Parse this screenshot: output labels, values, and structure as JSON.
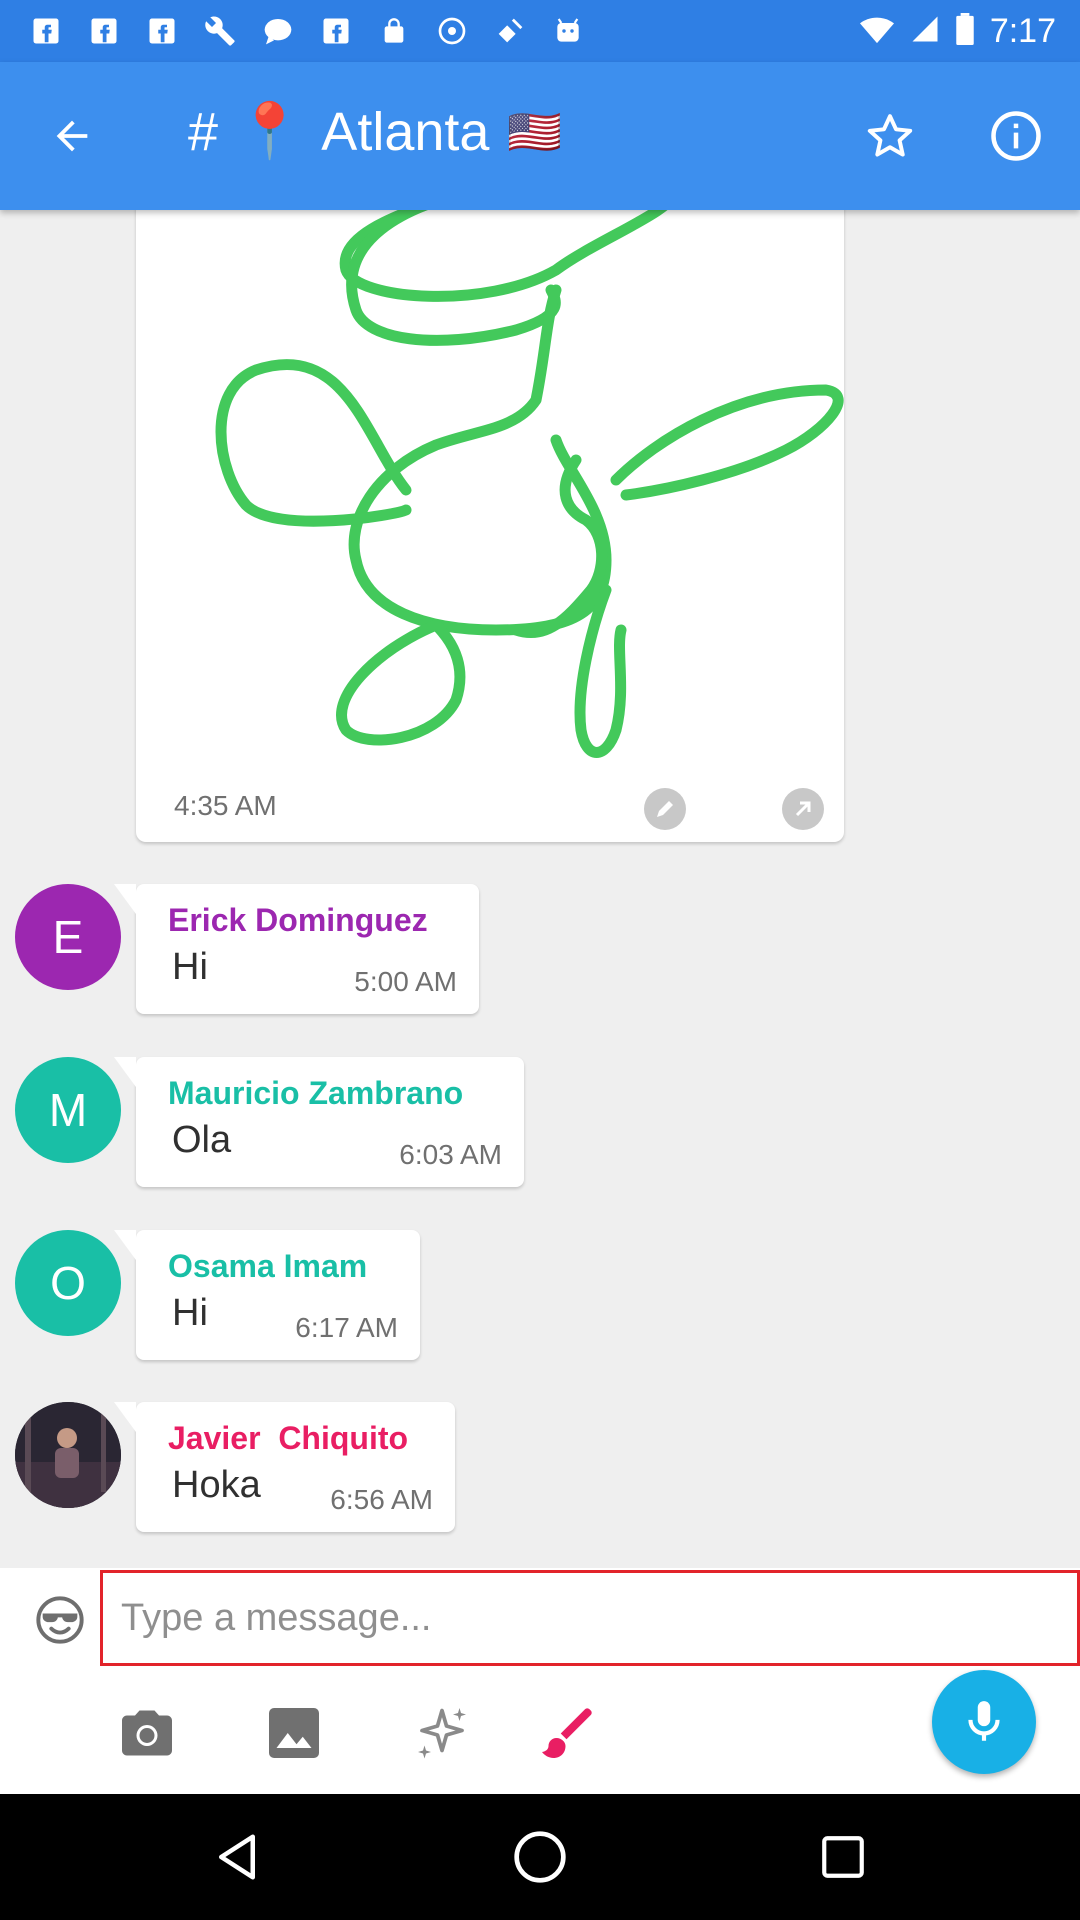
{
  "status_bar": {
    "time": "7:17",
    "icons": [
      "facebook-icon",
      "facebook-icon",
      "facebook-icon",
      "wrench-icon",
      "chat-bubble-icon",
      "facebook-icon",
      "lock-icon",
      "sync-icon",
      "fake-gps-icon",
      "android-icon",
      "wifi-icon",
      "signal-icon",
      "battery-icon"
    ]
  },
  "app_bar": {
    "hash": "#",
    "pin": "📍",
    "title": "Atlanta",
    "flag": "🇺🇸"
  },
  "drawing_card": {
    "time": "4:35 AM",
    "stroke_color": "#43c95b"
  },
  "messages": [
    {
      "avatar_letter": "E",
      "avatar_color": "#9c27b0",
      "sender": "Erick Dominguez",
      "sender_color": "#9c27b0",
      "text": "Hi",
      "time": "5:00 AM"
    },
    {
      "avatar_letter": "M",
      "avatar_color": "#19bfa6",
      "sender": "Mauricio Zambrano",
      "sender_color": "#19bfa6",
      "text": "Ola",
      "time": "6:03 AM"
    },
    {
      "avatar_letter": "O",
      "avatar_color": "#19bfa6",
      "sender": "Osama Imam",
      "sender_color": "#19bfa6",
      "text": "Hi",
      "time": "6:17 AM"
    },
    {
      "avatar_letter": "",
      "avatar_color": "#2a2633",
      "sender": "Javier  Chiquito",
      "sender_color": "#e91e63",
      "text": "Hoka",
      "time": "6:56 AM"
    }
  ],
  "composer": {
    "placeholder": "Type a message..."
  },
  "tools": [
    "camera-icon",
    "image-icon",
    "sparkle-icon",
    "brush-icon",
    "microphone-icon"
  ]
}
